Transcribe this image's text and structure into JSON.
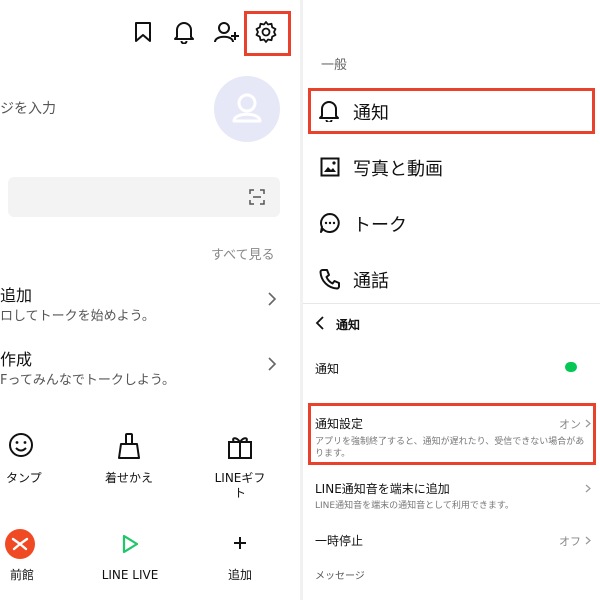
{
  "left": {
    "search_placeholder": "ジを入力",
    "see_all": "すべて見る",
    "rows": [
      {
        "title": "追加",
        "subtitle": "ロしてトークを始めよう。"
      },
      {
        "title": "作成",
        "subtitle": "Fってみんなでトークしよう。"
      }
    ],
    "grid": [
      {
        "label": "タンプ",
        "icon": "smile-icon"
      },
      {
        "label": "着せかえ",
        "icon": "brush-icon"
      },
      {
        "label": "LINEギフト",
        "icon": "gift-icon"
      },
      {
        "label": "前館",
        "icon": "demae-icon"
      },
      {
        "label": "LINE LIVE",
        "icon": "play-icon"
      },
      {
        "label": "追加",
        "icon": "plus-icon"
      }
    ],
    "header_icons": [
      "bookmark-icon",
      "bell-icon",
      "add-friend-icon",
      "gear-icon"
    ]
  },
  "right": {
    "section_label": "一般",
    "menu": [
      {
        "label": "通知",
        "icon": "bell-icon"
      },
      {
        "label": "写真と動画",
        "icon": "photo-icon"
      },
      {
        "label": "トーク",
        "icon": "chat-icon"
      },
      {
        "label": "通話",
        "icon": "phone-icon"
      }
    ],
    "sub_header": "通知",
    "notify_toggle_label": "通知",
    "notify_settings": {
      "title": "通知設定",
      "value": "オン",
      "desc": "アプリを強制終了すると、通知が遅れたり、受信できない場合があります。"
    },
    "line_sound": {
      "title": "LINE通知音を端末に追加",
      "desc": "LINE通知音を端末の通知音として利用できます。"
    },
    "pause": {
      "title": "一時停止",
      "value": "オフ"
    },
    "message_label": "メッセージ"
  },
  "colors": {
    "highlight": "#e8412c",
    "toggle_on": "#06c755",
    "line_live_green": "#1fc76b",
    "demae_red": "#f04a24"
  }
}
